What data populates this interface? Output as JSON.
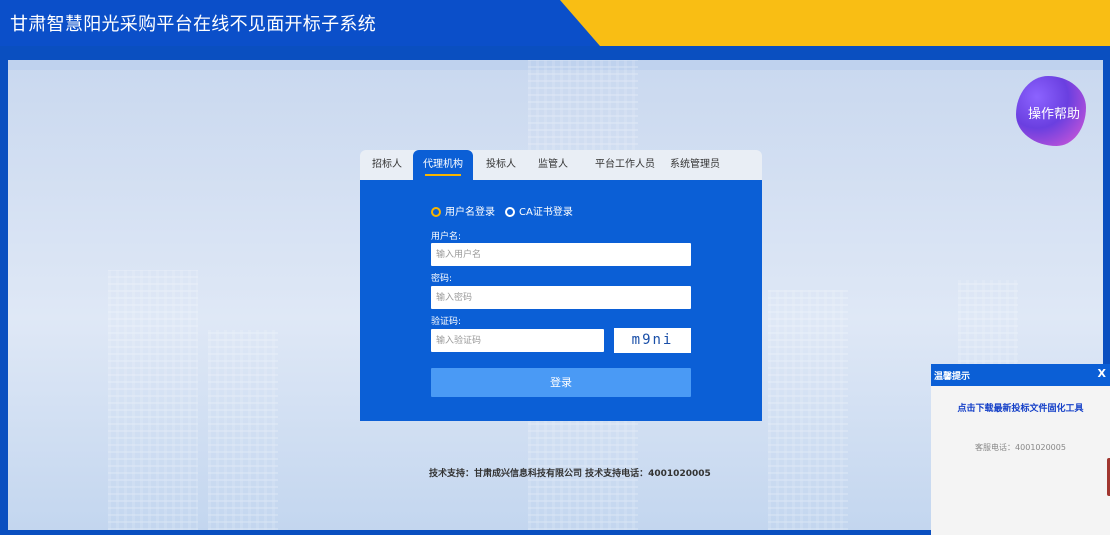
{
  "header": {
    "title": "甘肃智慧阳光采购平台在线不见面开标子系统"
  },
  "help": {
    "label": "操作帮助"
  },
  "login": {
    "tabs": [
      "招标人",
      "代理机构",
      "投标人",
      "监管人",
      "平台工作人员",
      "系统管理员"
    ],
    "active_tab": "代理机构",
    "modes": {
      "username": "用户名登录",
      "ca": "CA证书登录"
    },
    "username": {
      "label": "用户名:",
      "placeholder": "输入用户名"
    },
    "password": {
      "label": "密码:",
      "placeholder": "输入密码"
    },
    "captcha": {
      "label": "验证码:",
      "placeholder": "输入验证码",
      "code": "m9ni"
    },
    "submit": "登录"
  },
  "footer": {
    "text": "技术支持：甘肃成兴信息科技有限公司  技术支持电话：4001020005"
  },
  "popup": {
    "title": "温馨提示",
    "close": "X",
    "link": "点击下载最新投标文件固化工具",
    "phone": "客服电话：4001020005"
  },
  "colors": {
    "primary": "#0b5fd6",
    "header_blue": "#0b4fc9",
    "accent_yellow": "#f9be14",
    "button": "#4a9af5"
  }
}
